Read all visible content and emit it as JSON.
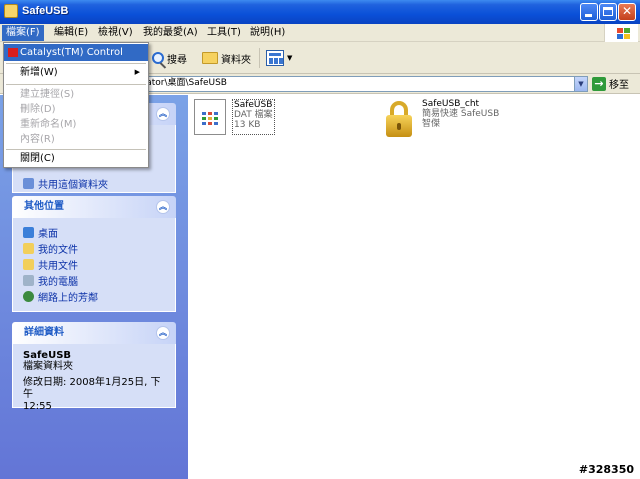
{
  "window": {
    "title": "SafeUSB"
  },
  "menubar": {
    "items": [
      "檔案(F)",
      "編輯(E)",
      "檢視(V)",
      "我的最愛(A)",
      "工具(T)",
      "說明(H)"
    ]
  },
  "toolbar": {
    "search_label": "搜尋",
    "folders_label": "資料夾"
  },
  "address": {
    "path": "ngs\\Administrator\\桌面\\SafeUSB",
    "go_label": "移至"
  },
  "file_menu": {
    "items": [
      {
        "label": "Catalyst(TM) Control Center",
        "enabled": true
      },
      {
        "label": "新增(W)",
        "enabled": true,
        "submenu": true
      },
      {
        "label": "建立捷徑(S)",
        "enabled": false
      },
      {
        "label": "刪除(D)",
        "enabled": false
      },
      {
        "label": "重新命名(M)",
        "enabled": false
      },
      {
        "label": "內容(R)",
        "enabled": false
      },
      {
        "label": "關閉(C)",
        "enabled": true
      }
    ]
  },
  "task_pane": {
    "hidden_panel_item": "共用這個資料夾",
    "other_places": {
      "title": "其他位置",
      "links": [
        "桌面",
        "我的文件",
        "共用文件",
        "我的電腦",
        "網路上的芳鄰"
      ]
    },
    "details": {
      "title": "詳細資料",
      "name": "SafeUSB",
      "type": "檔案資料夾",
      "modified": "修改日期: 2008年1月25日, 下午",
      "time": "12:55"
    }
  },
  "files": [
    {
      "name": "SafeUSB",
      "line2": "DAT 檔案",
      "line3": "13 KB",
      "icon": "dat-file-icon"
    },
    {
      "name": "SafeUSB_cht",
      "line2": "簡易快速 SafeUSB",
      "line3": "智傑",
      "icon": "lock-icon"
    }
  ],
  "watermark": "#328350",
  "colors": {
    "title_bar": "#0a50d8",
    "task_pane": "#7ba2e7",
    "highlight": "#316ac5",
    "link": "#0c32a8"
  }
}
